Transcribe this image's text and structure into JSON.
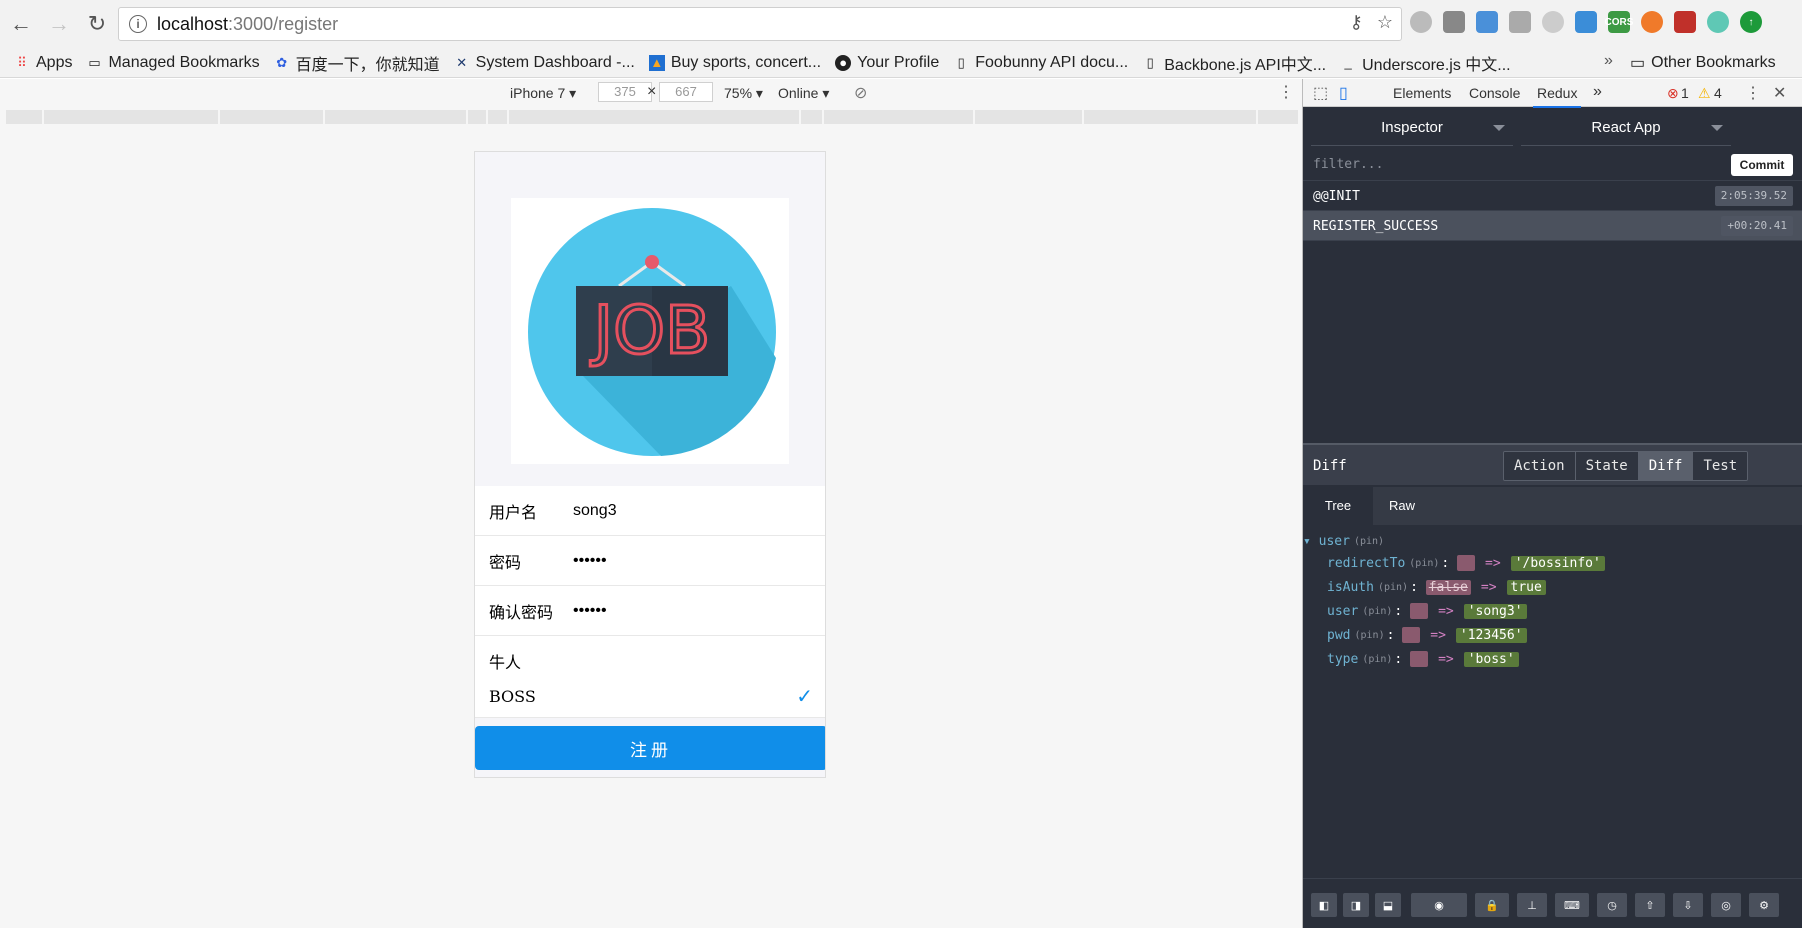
{
  "browser": {
    "url_host": "localhost",
    "url_path": ":3000/register",
    "bookmarks": [
      {
        "label": "Apps",
        "icon": "apps-grid-icon"
      },
      {
        "label": "Managed Bookmarks",
        "icon": "folder-icon"
      },
      {
        "label": "百度一下，你就知道",
        "icon": "baidu-paw-icon"
      },
      {
        "label": "System Dashboard -...",
        "icon": "jira-icon"
      },
      {
        "label": "Buy sports, concert...",
        "icon": "ticket-icon"
      },
      {
        "label": "Your Profile",
        "icon": "github-icon"
      },
      {
        "label": "Foobunny API docu...",
        "icon": "page-icon"
      },
      {
        "label": "Backbone.js API中文...",
        "icon": "page-icon"
      },
      {
        "label": "Underscore.js 中文...",
        "icon": "underscore-icon"
      }
    ],
    "bookmarks_more": "»",
    "other_bookmarks": "Other Bookmarks"
  },
  "device_toolbar": {
    "device": "iPhone 7",
    "width": "375",
    "times": "×",
    "height": "667",
    "zoom": "75%",
    "network": "Online"
  },
  "app": {
    "logo_text": "JOB",
    "fields": [
      {
        "label": "用户名",
        "value": "song3"
      },
      {
        "label": "密码",
        "value": "••••••"
      },
      {
        "label": "确认密码",
        "value": "••••••"
      }
    ],
    "roles": [
      {
        "label": "牛人",
        "checked": false
      },
      {
        "label": "BOSS",
        "checked": true
      }
    ],
    "check_glyph": "✓",
    "register_button": "注册"
  },
  "devtools": {
    "tabs": [
      "Elements",
      "Console",
      "Redux"
    ],
    "more_tabs": "»",
    "error_count": "1",
    "warning_count": "4",
    "monitor_select": "Inspector",
    "app_select": "React App",
    "filter_placeholder": "filter...",
    "commit_button": "Commit",
    "actions": [
      {
        "name": "@@INIT",
        "time": "2:05:39.52",
        "selected": false
      },
      {
        "name": "REGISTER_SUCCESS",
        "time": "+00:20.41",
        "selected": true
      }
    ],
    "diff_title": "Diff",
    "detail_tabs": [
      "Action",
      "State",
      "Diff",
      "Test"
    ],
    "active_detail_tab": "Diff",
    "view_tabs": [
      "Tree",
      "Raw"
    ],
    "tree": {
      "root_key": "user",
      "pin": "(pin)",
      "arrow": "=>",
      "entries": [
        {
          "key": "redirectTo",
          "old": "",
          "new": "'/bossinfo'"
        },
        {
          "key": "isAuth",
          "old": "false",
          "new": "true"
        },
        {
          "key": "user",
          "old": "",
          "new": "'song3'"
        },
        {
          "key": "pwd",
          "old": "",
          "new": "'123456'"
        },
        {
          "key": "type",
          "old": "",
          "new": "'boss'"
        }
      ]
    }
  }
}
